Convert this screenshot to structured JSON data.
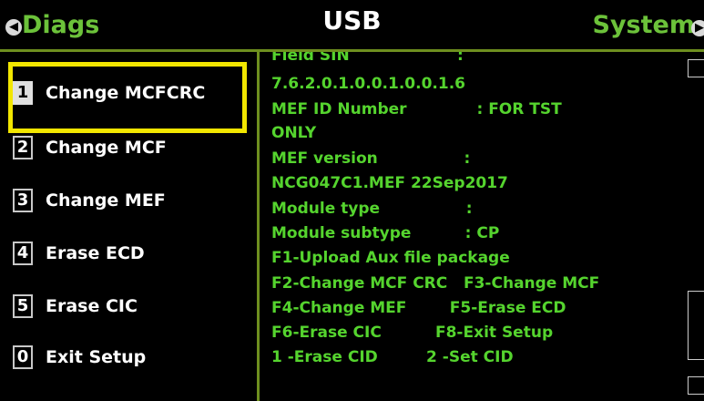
{
  "header": {
    "left_label": "Diags",
    "title": "USB",
    "right_label": "System"
  },
  "menu": [
    {
      "key": "1",
      "label": "Change MCFCRC",
      "selected": true
    },
    {
      "key": "2",
      "label": "Change MCF",
      "selected": false
    },
    {
      "key": "3",
      "label": "Change MEF",
      "selected": false
    },
    {
      "key": "4",
      "label": "Erase ECD",
      "selected": false
    },
    {
      "key": "5",
      "label": "Erase CIC",
      "selected": false
    },
    {
      "key": "0",
      "label": "Exit Setup",
      "selected": false
    }
  ],
  "content_lines": [
    "Field SIN                    :",
    "7.6.2.0.1.0.0.1.0.0.1.6",
    "MEF ID Number             : FOR TST",
    "ONLY",
    "MEF version                :",
    "NCG047C1.MEF 22Sep2017",
    "Module type                :",
    "Module subtype          : CP",
    "F1-Upload Aux file package",
    "F2-Change MCF CRC   F3-Change MCF",
    "F4-Change MEF        F5-Erase ECD",
    "F6-Erase CIC          F8-Exit Setup",
    "1 -Erase CID         2 -Set CID"
  ],
  "colors": {
    "content_text": "#55d42e",
    "header_side_text": "#6cc23a",
    "divider": "#6e8f1f",
    "selection_highlight": "#f2e600"
  }
}
